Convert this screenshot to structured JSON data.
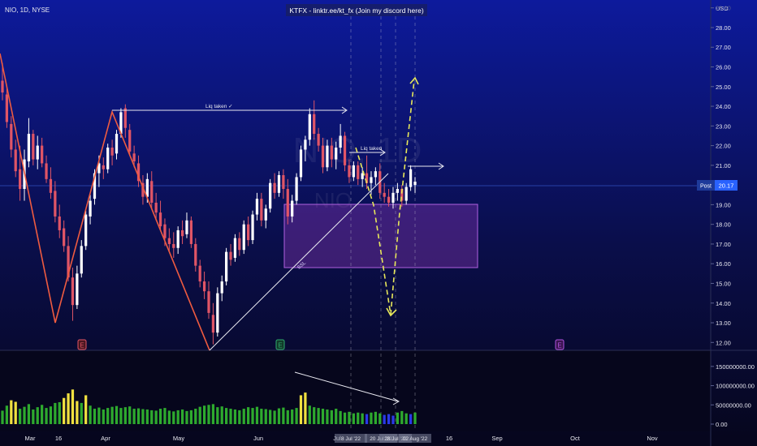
{
  "header": {
    "symbol_label": "NIO, 1D, NYSE",
    "title": "KTFX - linktr.ee/kt_fx (Join my discord here)"
  },
  "watermark": {
    "ticker": "NIO, 1D",
    "sub": "NIO"
  },
  "price_axis": {
    "currency": "USD",
    "ticks": [
      "29.00",
      "28.00",
      "27.00",
      "26.00",
      "25.00",
      "24.00",
      "23.00",
      "22.00",
      "21.00",
      "20.00",
      "19.00",
      "18.00",
      "17.00",
      "16.00",
      "15.00",
      "14.00",
      "13.00",
      "12.00"
    ],
    "post_label": "Post",
    "post_price": "20.17"
  },
  "volume_axis": {
    "ticks": [
      "150000000.00",
      "100000000.00",
      "50000000.00",
      "0.00"
    ]
  },
  "time_axis": {
    "labels": [
      "Mar",
      "16",
      "Apr",
      "May",
      "Jun",
      "Jul",
      "Sep",
      "Oct",
      "Nov"
    ],
    "cursor_labels": [
      "8 Jul '22",
      "20 Jul '22",
      "28 Jul '22",
      "02 Aug '22"
    ]
  },
  "annotations": {
    "liq1": "Liq taken ✓",
    "liq2": "Liq taken",
    "trend_label": "SSL",
    "earnings_marks": [
      "E",
      "E",
      "E"
    ]
  },
  "colors": {
    "background_top": "#0d1a9c",
    "background_bottom": "#05051a",
    "up": "#ffffff",
    "down": "#e05566",
    "zigzag": "#ef5b40",
    "zone": "#9a3cc4",
    "dashed_projection": "#e8e85a",
    "volume_normal": "#2eaa2e",
    "volume_high": "#f0e040",
    "volume_low": "#2a3ae8",
    "post_badge": "#2962ff"
  },
  "chart_data": {
    "type": "candlestick",
    "title": "",
    "xlabel": "",
    "ylabel": "USD",
    "ylim": [
      11.6,
      29.4
    ],
    "candles": [
      [
        25.3,
        26.2,
        24.3,
        24.7
      ],
      [
        24.6,
        25.0,
        22.9,
        23.2
      ],
      [
        23.1,
        23.5,
        21.4,
        21.8
      ],
      [
        21.8,
        22.3,
        20.4,
        20.7
      ],
      [
        20.8,
        22.0,
        19.2,
        19.8
      ],
      [
        19.8,
        21.8,
        19.2,
        21.3
      ],
      [
        21.2,
        23.4,
        20.9,
        22.6
      ],
      [
        22.6,
        22.8,
        21.0,
        21.3
      ],
      [
        21.3,
        22.5,
        20.8,
        22.0
      ],
      [
        22.0,
        22.4,
        20.9,
        21.1
      ],
      [
        21.1,
        21.5,
        20.1,
        20.3
      ],
      [
        20.3,
        20.9,
        19.3,
        19.6
      ],
      [
        19.7,
        20.2,
        18.1,
        18.4
      ],
      [
        18.4,
        19.0,
        17.3,
        17.7
      ],
      [
        17.8,
        18.2,
        16.6,
        16.9
      ],
      [
        16.9,
        17.4,
        15.1,
        15.3
      ],
      [
        15.3,
        15.8,
        13.1,
        13.9
      ],
      [
        13.9,
        15.9,
        13.7,
        15.5
      ],
      [
        15.5,
        17.2,
        15.3,
        16.9
      ],
      [
        16.9,
        18.7,
        16.7,
        18.5
      ],
      [
        18.4,
        19.5,
        18.0,
        19.2
      ],
      [
        19.3,
        20.8,
        19.0,
        20.6
      ],
      [
        20.6,
        21.5,
        19.9,
        21.1
      ],
      [
        21.0,
        21.4,
        20.3,
        20.8
      ],
      [
        20.8,
        22.1,
        20.6,
        21.9
      ],
      [
        21.9,
        22.3,
        21.0,
        21.5
      ],
      [
        21.6,
        22.8,
        21.3,
        22.6
      ],
      [
        22.6,
        23.9,
        22.4,
        23.7
      ],
      [
        23.9,
        24.1,
        22.4,
        22.9
      ],
      [
        22.8,
        23.1,
        21.5,
        21.7
      ],
      [
        21.6,
        22.0,
        20.9,
        21.2
      ],
      [
        21.1,
        21.5,
        19.9,
        20.2
      ],
      [
        20.1,
        20.5,
        19.0,
        19.4
      ],
      [
        19.4,
        20.6,
        19.1,
        20.3
      ],
      [
        20.2,
        20.7,
        18.8,
        19.1
      ],
      [
        19.1,
        19.6,
        18.2,
        18.6
      ],
      [
        18.6,
        19.2,
        17.7,
        17.9
      ],
      [
        18.0,
        18.3,
        16.9,
        17.3
      ],
      [
        17.3,
        17.8,
        16.6,
        17.0
      ],
      [
        17.0,
        17.6,
        16.3,
        16.8
      ],
      [
        16.8,
        17.9,
        16.5,
        17.7
      ],
      [
        17.7,
        18.2,
        17.0,
        17.4
      ],
      [
        17.5,
        18.6,
        17.3,
        18.2
      ],
      [
        18.2,
        18.4,
        16.8,
        17.0
      ],
      [
        17.0,
        17.3,
        15.6,
        15.9
      ],
      [
        15.9,
        16.2,
        14.8,
        15.1
      ],
      [
        15.1,
        15.6,
        14.2,
        14.6
      ],
      [
        14.6,
        15.1,
        13.2,
        13.5
      ],
      [
        13.4,
        14.0,
        11.9,
        12.5
      ],
      [
        12.5,
        14.8,
        12.3,
        14.5
      ],
      [
        14.5,
        15.4,
        14.1,
        15.1
      ],
      [
        15.1,
        16.8,
        14.9,
        16.6
      ],
      [
        16.6,
        17.0,
        15.9,
        16.2
      ],
      [
        16.3,
        17.5,
        16.1,
        17.3
      ],
      [
        17.3,
        17.6,
        16.4,
        16.7
      ],
      [
        16.7,
        18.2,
        16.5,
        18.0
      ],
      [
        18.0,
        18.4,
        16.9,
        17.2
      ],
      [
        17.2,
        18.7,
        17.0,
        18.5
      ],
      [
        18.5,
        19.6,
        18.2,
        19.3
      ],
      [
        19.3,
        19.6,
        17.9,
        18.2
      ],
      [
        18.2,
        19.0,
        17.8,
        18.8
      ],
      [
        18.8,
        20.3,
        18.6,
        20.1
      ],
      [
        20.1,
        20.6,
        19.3,
        19.6
      ],
      [
        19.6,
        20.7,
        19.4,
        20.5
      ],
      [
        20.5,
        20.8,
        19.3,
        19.8
      ],
      [
        19.8,
        20.3,
        18.0,
        18.4
      ],
      [
        18.4,
        19.5,
        18.1,
        19.2
      ],
      [
        19.2,
        20.6,
        19.0,
        20.4
      ],
      [
        20.4,
        22.0,
        20.2,
        21.8
      ],
      [
        21.8,
        22.5,
        21.2,
        22.3
      ],
      [
        22.3,
        23.9,
        22.0,
        23.6
      ],
      [
        23.6,
        24.3,
        22.3,
        22.6
      ],
      [
        22.6,
        22.9,
        21.7,
        22.0
      ],
      [
        22.0,
        22.4,
        20.6,
        20.9
      ],
      [
        20.9,
        22.3,
        20.7,
        22.0
      ],
      [
        22.0,
        22.4,
        20.9,
        21.3
      ],
      [
        21.3,
        22.2,
        20.8,
        21.9
      ],
      [
        21.9,
        23.1,
        21.6,
        22.5
      ],
      [
        22.5,
        22.7,
        20.7,
        21.0
      ],
      [
        21.0,
        21.3,
        20.1,
        20.4
      ],
      [
        20.4,
        21.2,
        20.2,
        21.0
      ],
      [
        21.0,
        21.2,
        20.0,
        20.3
      ],
      [
        20.3,
        20.9,
        19.9,
        20.6
      ],
      [
        20.6,
        21.5,
        19.8,
        20.1
      ],
      [
        20.1,
        20.7,
        19.5,
        20.4
      ],
      [
        20.4,
        20.9,
        20.0,
        20.7
      ],
      [
        20.7,
        21.1,
        19.3,
        19.6
      ],
      [
        19.6,
        20.1,
        19.1,
        19.4
      ],
      [
        19.4,
        19.8,
        18.9,
        19.1
      ],
      [
        19.1,
        19.9,
        18.8,
        19.6
      ],
      [
        19.6,
        20.1,
        19.2,
        19.8
      ],
      [
        19.8,
        20.0,
        18.9,
        19.2
      ],
      [
        19.2,
        20.1,
        19.0,
        19.9
      ],
      [
        19.9,
        21.0,
        19.7,
        20.8
      ],
      [
        20.0,
        20.4,
        19.6,
        20.17
      ]
    ],
    "volume": [
      35,
      48,
      62,
      58,
      40,
      45,
      52,
      38,
      44,
      50,
      42,
      46,
      55,
      57,
      68,
      80,
      90,
      60,
      55,
      75,
      48,
      40,
      43,
      38,
      42,
      45,
      47,
      42,
      44,
      46,
      40,
      41,
      39,
      38,
      36,
      35,
      40,
      42,
      35,
      33,
      36,
      38,
      34,
      36,
      40,
      45,
      48,
      50,
      52,
      44,
      46,
      42,
      40,
      38,
      36,
      40,
      44,
      42,
      45,
      40,
      39,
      37,
      35,
      41,
      43,
      36,
      38,
      42,
      75,
      82,
      48,
      44,
      42,
      40,
      38,
      36,
      40,
      34,
      30,
      32,
      28,
      30,
      28,
      26,
      30,
      32,
      28,
      24,
      26,
      22,
      30,
      34,
      28,
      26,
      30
    ],
    "volume_ylim": [
      0,
      175
    ]
  }
}
